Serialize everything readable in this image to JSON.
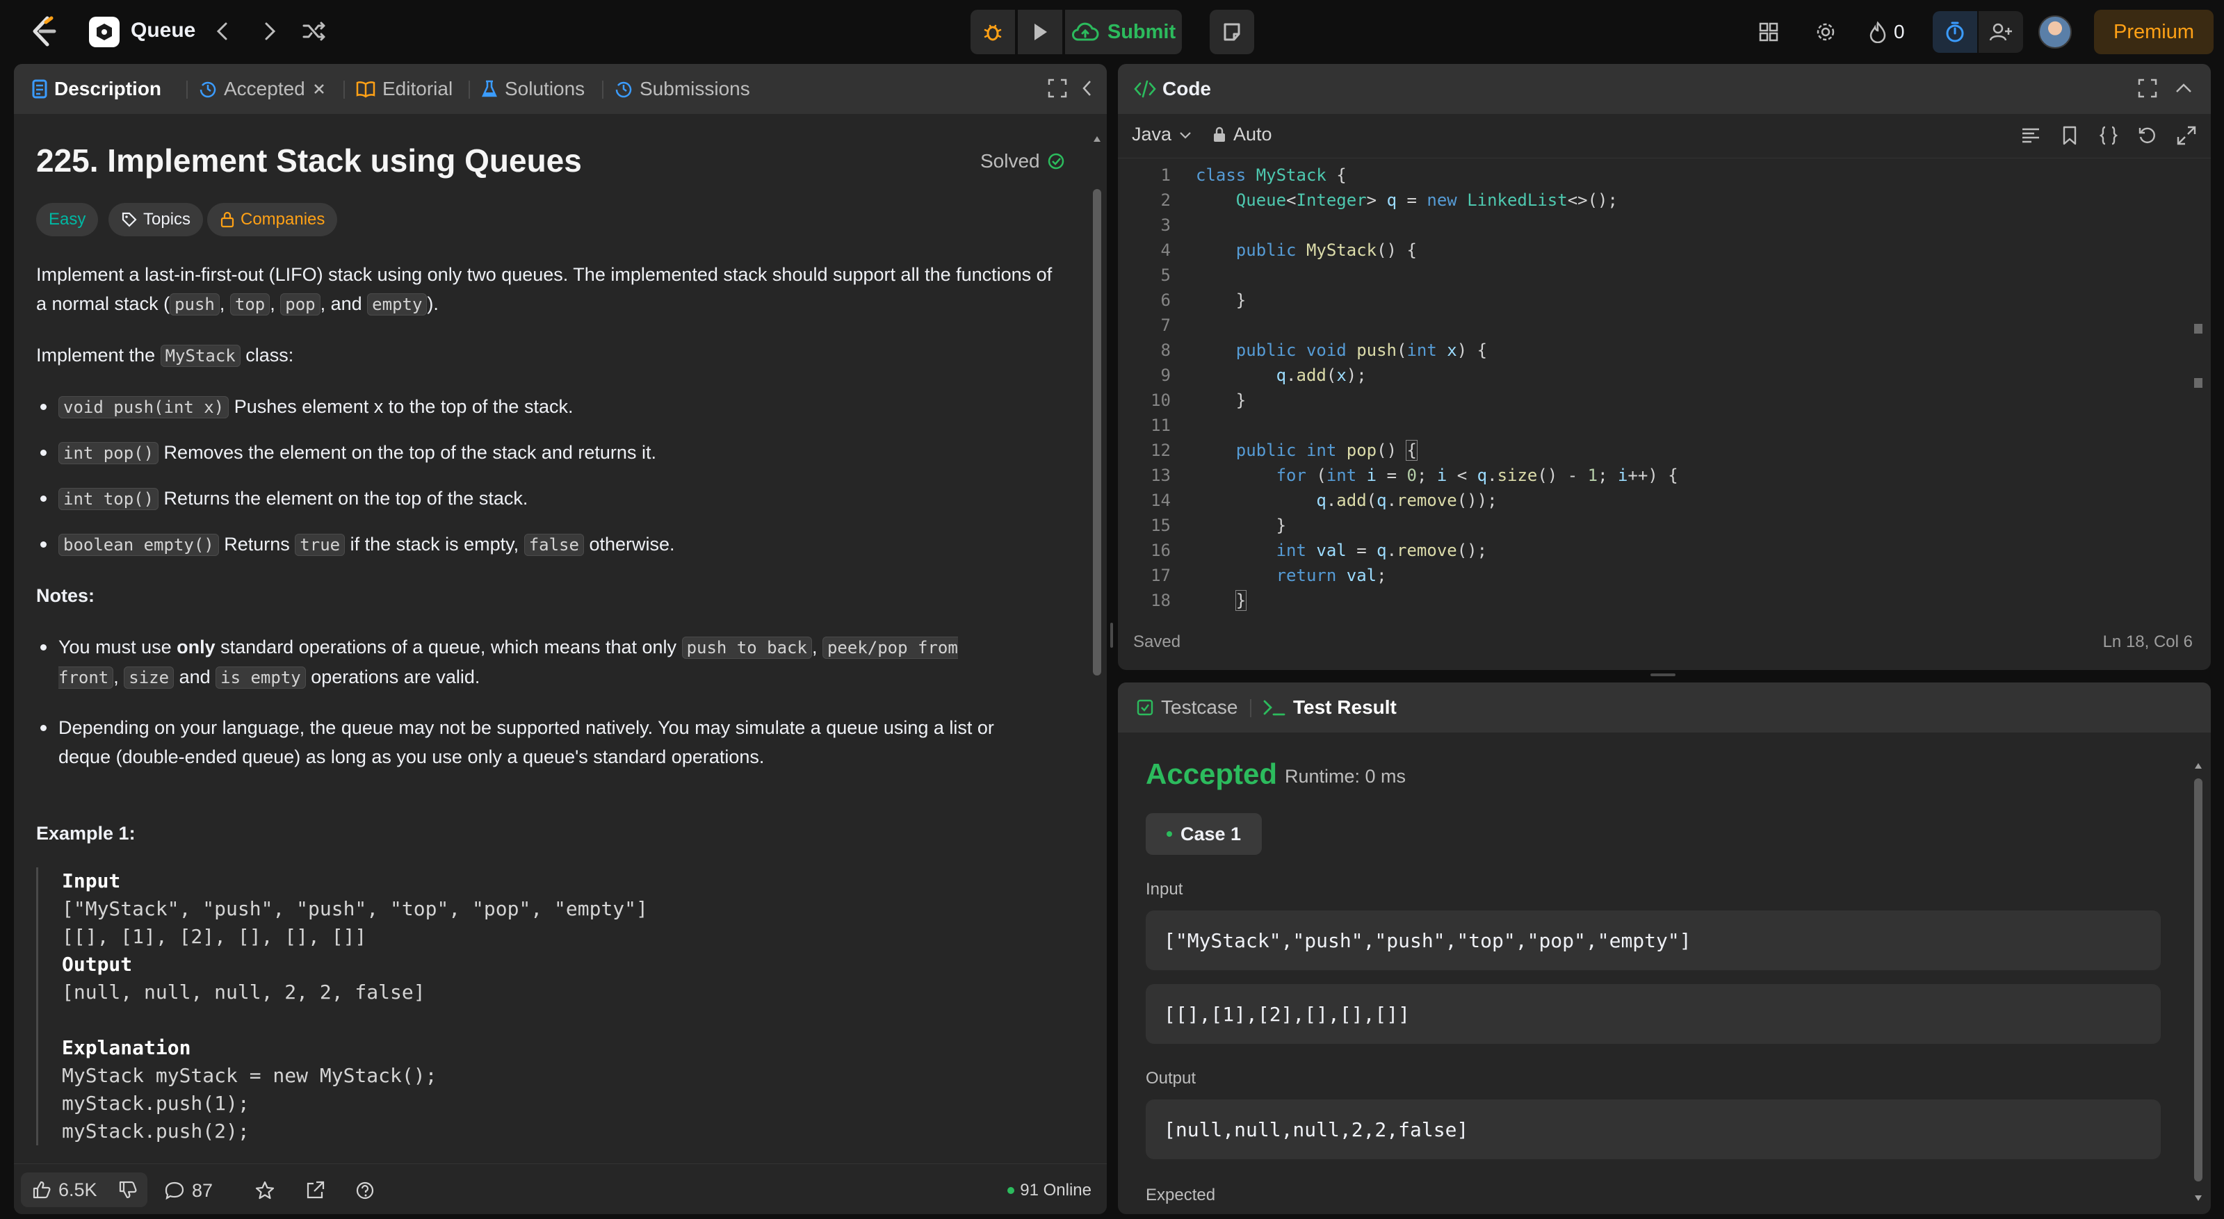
{
  "topbar": {
    "problem_list_title": "Queue",
    "submit_label": "Submit",
    "streak_count": "0",
    "premium_label": "Premium"
  },
  "left_panel": {
    "tabs": [
      {
        "label": "Description",
        "icon": "description-icon",
        "active": true
      },
      {
        "label": "Accepted",
        "icon": "history-icon",
        "closable": true
      },
      {
        "label": "Editorial",
        "icon": "book-icon"
      },
      {
        "label": "Solutions",
        "icon": "flask-icon"
      },
      {
        "label": "Submissions",
        "icon": "history-icon"
      }
    ],
    "problem": {
      "title": "225. Implement Stack using Queues",
      "status": "Solved",
      "difficulty": "Easy",
      "topics_label": "Topics",
      "companies_label": "Companies",
      "intro_1": "Implement a last-in-first-out (LIFO) stack using only two queues. The implemented stack should support all the functions of a normal stack (",
      "intro_codes": [
        "push",
        "top",
        "pop",
        "empty"
      ],
      "implement_prefix": "Implement the ",
      "implement_code": "MyStack",
      "implement_suffix": " class:",
      "methods": [
        {
          "code": "void push(int x)",
          "text": " Pushes element x to the top of the stack."
        },
        {
          "code": "int pop()",
          "text": " Removes the element on the top of the stack and returns it."
        },
        {
          "code": "int top()",
          "text": " Returns the element on the top of the stack."
        },
        {
          "code": "boolean empty()",
          "text": " Returns ",
          "code2": "true",
          "text2": " if the stack is empty, ",
          "code3": "false",
          "text3": " otherwise."
        }
      ],
      "notes_label": "Notes:",
      "note_1_a": "You must use ",
      "note_1_b": "only",
      "note_1_c": " standard operations of a queue, which means that only ",
      "note_1_codes": [
        "push to back",
        "peek/pop from front",
        "size",
        "is empty"
      ],
      "note_1_and": " and ",
      "note_1_end": " operations are valid.",
      "note_2": "Depending on your language, the queue may not be supported natively. You may simulate a queue using a list or deque (double-ended queue) as long as you use only a queue's standard operations.",
      "example_title": "Example 1:",
      "example_input_label": "Input",
      "example_input_1": "[\"MyStack\", \"push\", \"push\", \"top\", \"pop\", \"empty\"]",
      "example_input_2": "[[], [1], [2], [], [], []]",
      "example_output_label": "Output",
      "example_output": "[null, null, null, 2, 2, false]",
      "example_expl_label": "Explanation",
      "example_expl_lines": [
        "MyStack myStack = new MyStack();",
        "myStack.push(1);",
        "myStack.push(2);"
      ]
    },
    "footer": {
      "likes": "6.5K",
      "comments": "87",
      "online": "91 Online"
    }
  },
  "code_panel": {
    "title": "Code",
    "language": "Java",
    "mode": "Auto",
    "status": "Saved",
    "cursor": "Ln 18, Col 6",
    "line_numbers": [
      "1",
      "2",
      "3",
      "4",
      "5",
      "6",
      "7",
      "8",
      "9",
      "10",
      "11",
      "12",
      "13",
      "14",
      "15",
      "16",
      "17",
      "18"
    ]
  },
  "result_panel": {
    "tab_testcase": "Testcase",
    "tab_result": "Test Result",
    "verdict": "Accepted",
    "runtime": "Runtime: 0 ms",
    "case_label": "Case 1",
    "input_label": "Input",
    "input_1": "[\"MyStack\",\"push\",\"push\",\"top\",\"pop\",\"empty\"]",
    "input_2": "[[],[1],[2],[],[],[]]",
    "output_label": "Output",
    "output": "[null,null,null,2,2,false]",
    "expected_label": "Expected"
  },
  "colors": {
    "accent_green": "#2cbb5d",
    "easy": "#00b8a3",
    "premium": "#ffa116",
    "timer_blue": "#3b9cff"
  }
}
